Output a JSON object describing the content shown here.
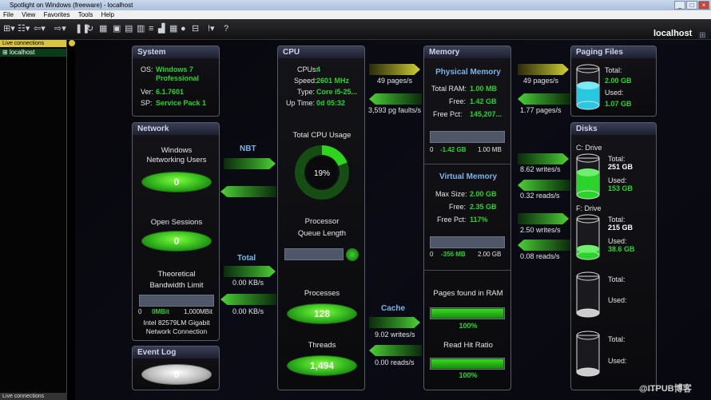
{
  "window": {
    "title": "Spotlight on Windows (freeware) - localhost",
    "min": "_",
    "max": "□",
    "close": "×"
  },
  "menu": [
    "File",
    "View",
    "Favorites",
    "Tools",
    "Help"
  ],
  "toolbar": {
    "hostname": "localhost"
  },
  "left_panel": {
    "header": "Live connections",
    "item": "localhost",
    "footer": "Live connections"
  },
  "system": {
    "title": "System",
    "os_label": "OS:",
    "os_value_1": "Windows 7",
    "os_value_2": "Professional",
    "ver_label": "Ver:",
    "ver_value": "6.1.7601",
    "sp_label": "SP:",
    "sp_value": "Service Pack 1"
  },
  "network": {
    "title": "Network",
    "users_label_1": "Windows",
    "users_label_2": "Networking Users",
    "users_value": "0",
    "sessions_label": "Open Sessions",
    "sessions_value": "0",
    "bw_label_1": "Theoretical",
    "bw_label_2": "Bandwidth Limit",
    "bw_min": "0",
    "bw_current": "0MBit",
    "bw_max": "1,000MBit",
    "adapter_1": "Intel 82579LM Gigabit",
    "adapter_2": "Network Connection",
    "nbt_label": "NBT",
    "total_label": "Total",
    "rate_in": "0.00 KB/s",
    "rate_out": "0.00 KB/s"
  },
  "event_log": {
    "title": "Event Log",
    "value": "0"
  },
  "cpu": {
    "title": "CPU",
    "cpus_label": "CPUs:",
    "cpus_value": "4",
    "speed_label": "Speed:",
    "speed_value": "2601 MHz",
    "type_label": "Type:",
    "type_value": "Core i5-25...",
    "uptime_label": "Up Time:",
    "uptime_value": "0d 05:32",
    "usage_label": "Total CPU Usage",
    "usage_value": "19%",
    "usage_percent": 19,
    "queue_label_1": "Processor",
    "queue_label_2": "Queue Length",
    "processes_label": "Processes",
    "processes_value": "128",
    "threads_label": "Threads",
    "threads_value": "1,494"
  },
  "cpu_mem_flows": {
    "pages_rate": "49 pages/s",
    "faults_rate": "3,593 pg faults/s",
    "cache_label": "Cache",
    "cache_writes": "9.02 writes/s",
    "cache_reads": "0.00 reads/s"
  },
  "memory": {
    "title": "Memory",
    "phys_title": "Physical Memory",
    "total_label": "Total RAM:",
    "total_value": "1.00 MB",
    "free_label": "Free:",
    "free_value": "1.42 GB",
    "freepct_label": "Free Pct:",
    "freepct_value": "145,207...",
    "phys_min": "0",
    "phys_current": "-1.42 GB",
    "phys_max": "1.00 MB",
    "virt_title": "Virtual Memory",
    "max_label": "Max Size:",
    "max_value": "2.00 GB",
    "vfree_label": "Free:",
    "vfree_value": "2.35 GB",
    "vpct_label": "Free Pct:",
    "vpct_value": "117%",
    "virt_min": "0",
    "virt_current": "-356 MB",
    "virt_max": "2.00 GB",
    "pages_label": "Pages found in RAM",
    "pages_value": "100%",
    "pages_fill": 1.0,
    "hit_label": "Read Hit Ratio",
    "hit_value": "100%",
    "hit_fill": 1.0
  },
  "mem_disk_flows": {
    "pages_rate": "49 pages/s",
    "paging_rate": "1.77 pages/s",
    "c_writes": "8.62 writes/s",
    "c_reads": "0.32 reads/s",
    "f_writes": "2.50 writes/s",
    "f_reads": "0.08 reads/s"
  },
  "paging": {
    "title": "Paging Files",
    "total_label": "Total:",
    "total_value": "2.00 GB",
    "used_label": "Used:",
    "used_value": "1.07 GB",
    "fill": 0.54
  },
  "disks": {
    "title": "Disks",
    "c_label": "C: Drive",
    "c_total_label": "Total:",
    "c_total_value": "251 GB",
    "c_used_label": "Used:",
    "c_used_value": "153 GB",
    "c_fill": 0.61,
    "f_label": "F: Drive",
    "f_total_label": "Total:",
    "f_total_value": "215 GB",
    "f_used_label": "Used:",
    "f_used_value": "38.6 GB",
    "f_fill": 0.18,
    "d3_total_label": "Total:",
    "d3_used_label": "Used:",
    "d4_total_label": "Total:",
    "d4_used_label": "Used:"
  },
  "watermark": "@ITPUB博客",
  "colors": {
    "accent_green": "#29d429",
    "header_blue": "#7ab5e8",
    "cyan_fill": "#28c8e0"
  }
}
